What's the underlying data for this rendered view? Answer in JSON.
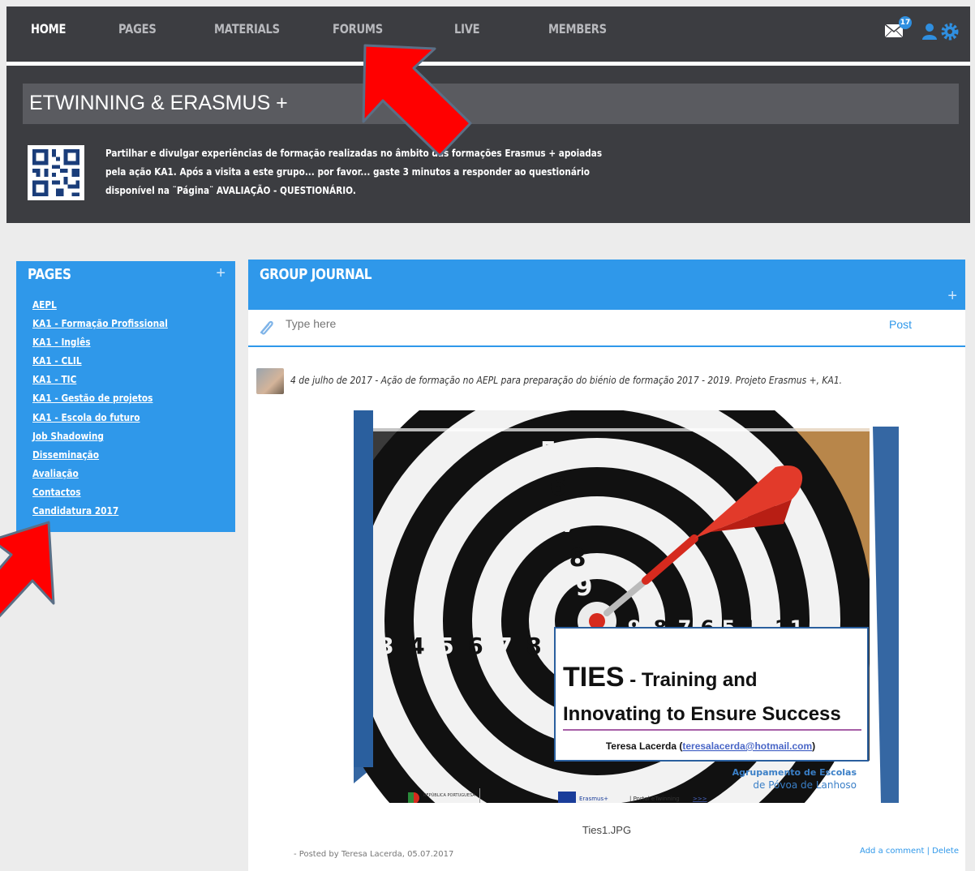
{
  "nav": {
    "items": [
      "HOME",
      "PAGES",
      "MATERIALS",
      "FORUMS",
      "LIVE",
      "MEMBERS"
    ],
    "active": "HOME",
    "notification_count": "17",
    "icons": [
      "mail-icon",
      "user-icon",
      "gear-icon"
    ]
  },
  "group": {
    "title": "ETWINNING & ERASMUS +",
    "description_lines": [
      "Partilhar e divulgar experiências de formação realizadas no âmbito das formações Erasmus + apoiadas",
      "pela ação KA1. Após a visita a este grupo... por favor... gaste 3 minutos a responder ao questionário",
      "disponível na ¨Página¨ AVALIAÇÃO - QUESTIONÁRIO."
    ]
  },
  "pages_panel": {
    "title": "PAGES",
    "plus": "+",
    "links": [
      "AEPL",
      "KA1 - Formação Profissional",
      "KA1 - Inglês",
      "KA1 - CLIL",
      "KA1 - TIC",
      "KA1 - Gestão de projetos",
      "KA1 - Escola do futuro",
      "Job Shadowing",
      "Disseminação",
      "Avaliação",
      "Contactos",
      "Candidatura 2017"
    ]
  },
  "journal": {
    "title": "GROUP JOURNAL",
    "plus": "+",
    "placeholder": "Type here",
    "post_label": "Post",
    "entry": {
      "text": "4 de julho de 2017 - Ação de formação no AEPL para preparação do biénio de formação 2017 - 2019. Projeto Erasmus +, KA1.",
      "image": {
        "heading_bold": "TIES",
        "heading_rest": " - Training and",
        "heading_line2": "Innovating to Ensure Success",
        "author": "Teresa Lacerda (",
        "email": "teresalacerda@hotmail.com",
        "author_end": ")",
        "school_line1": "Agrupamento de Escolas",
        "school_line2": "de Póvoa de Lanhoso",
        "numbers_ring": [
          "5",
          "6",
          "7",
          "8",
          "9"
        ],
        "numbers_row_left": [
          "3",
          "4",
          "5",
          "6",
          "7",
          "8",
          "9"
        ],
        "numbers_row_right": [
          "9",
          "8",
          "7",
          "6",
          "5",
          "4",
          "3",
          "2",
          "1"
        ],
        "footer_logos": [
          "REPÚBLICA PORTUGUESA",
          "Erasmus+",
          "| Portal eTwinning"
        ],
        "footer_link": ">>>"
      },
      "caption": "Ties1.JPG",
      "posted_by": "- Posted by Teresa Lacerda, 05.07.2017",
      "add_comment": "Add a comment",
      "separator": " | ",
      "delete": "Delete"
    }
  },
  "colors": {
    "dark": "#3c3d41",
    "accent_blue": "#2f98ea",
    "arrow_red": "#ff0000"
  }
}
